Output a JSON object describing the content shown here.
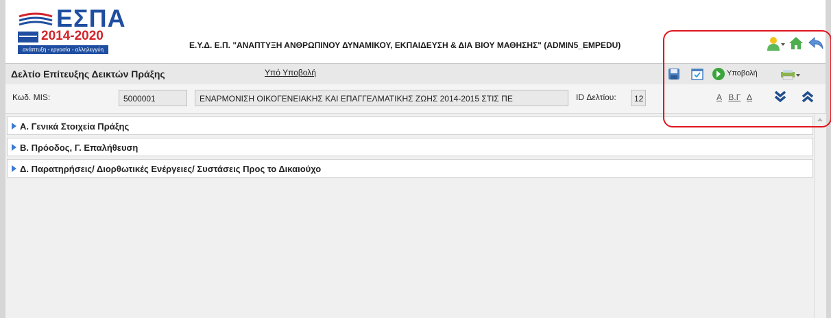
{
  "logo": {
    "title": "ΕΣΠΑ",
    "years": "2014-2020",
    "tagline": "ανάπτυξη - εργασία - αλληλεγγύη"
  },
  "header": {
    "program_title": "Ε.Υ.Δ. Ε.Π. \"ΑΝΑΠΤΥΞΗ ΑΝΘΡΩΠΙΝΟΥ ΔΥΝΑΜΙΚΟΥ, ΕΚΠΑΙΔΕΥΣΗ & ΔΙΑ ΒΙΟΥ ΜΑΘΗΣΗΣ\" (ADMIN5_EMPEDU)",
    "icons": [
      "user-menu-icon",
      "home-icon",
      "back-icon"
    ]
  },
  "titlebar": {
    "page_title": "Δελτίο Επίτευξης Δεικτών Πράξης",
    "status": "Υπό Υποβολή",
    "submit_label": "Υποβολή",
    "icons": [
      "save-icon",
      "check-icon",
      "submit-icon",
      "print-icon"
    ]
  },
  "info": {
    "mis_label": "Κωδ. MIS:",
    "mis_value": "5000001",
    "project_title": "ΕΝΑΡΜΟΝΙΣΗ ΟΙΚΟΓΕΝΕΙΑΚΗΣ ΚΑΙ ΕΠΑΓΓΕΛΜΑΤΙΚΗΣ ΖΩΗΣ 2014-2015 ΣΤΙΣ ΠΕ",
    "id_label": "ID Δελτίου:",
    "id_value": "12",
    "section_links": [
      "Α",
      "Β.Γ",
      "Δ"
    ]
  },
  "sections": [
    {
      "title": "Α. Γενικά Στοιχεία Πράξης"
    },
    {
      "title": "Β. Πρόοδος, Γ. Επαλήθευση"
    },
    {
      "title": "Δ. Παρατηρήσεις/ Διορθωτικές Ενέργειες/ Συστάσεις Προς το Δικαιούχο"
    }
  ],
  "colors": {
    "accent": "#3a7bd5",
    "annotation": "#e0141e",
    "logo_blue": "#1f4ea1",
    "logo_red": "#d3242a"
  }
}
